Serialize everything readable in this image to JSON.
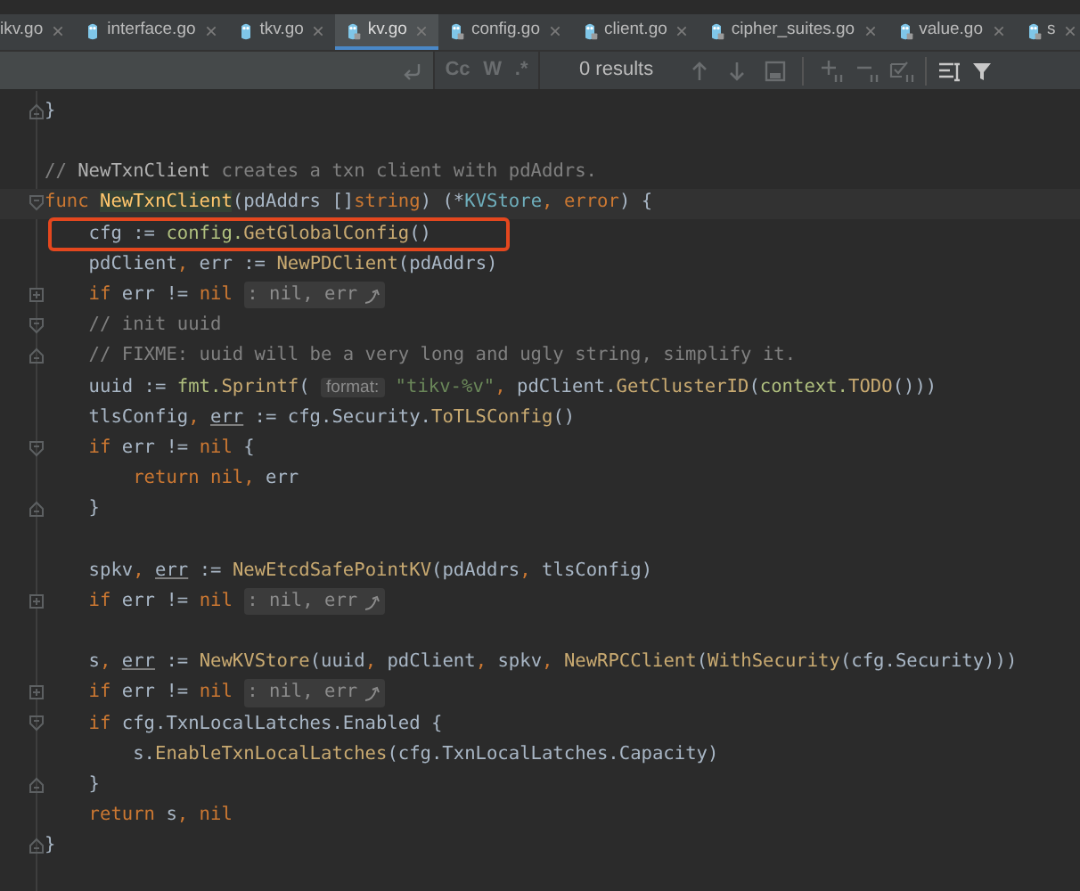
{
  "tabs": [
    {
      "label": "ikv.go",
      "selected": false
    },
    {
      "label": "interface.go",
      "selected": false,
      "locked": false
    },
    {
      "label": "tkv.go",
      "selected": false,
      "locked": false
    },
    {
      "label": "kv.go",
      "selected": true,
      "locked": true
    },
    {
      "label": "config.go",
      "selected": false,
      "locked": true
    },
    {
      "label": "client.go",
      "selected": false,
      "locked": true
    },
    {
      "label": "cipher_suites.go",
      "selected": false,
      "locked": true
    },
    {
      "label": "value.go",
      "selected": false,
      "locked": true
    },
    {
      "label": "s",
      "selected": false,
      "locked": true
    }
  ],
  "find_bar": {
    "options": [
      {
        "label": "Cc",
        "selected": false
      },
      {
        "label": "W",
        "selected": false
      },
      {
        "label": ".*",
        "selected": false
      }
    ],
    "results": "0 results"
  },
  "editor": {
    "lines": [
      {
        "kind": "fold_end",
        "segments": [
          {
            "kind": "plain",
            "text": "}"
          }
        ]
      },
      {
        "kind": "blank"
      },
      {
        "kind": "plain",
        "segments": [
          {
            "kind": "comment",
            "text": "// "
          },
          {
            "kind": "comment_ref",
            "text": "NewTxnClient"
          },
          {
            "kind": "comment",
            "text": " creates a txn client with pdAddrs."
          }
        ]
      },
      {
        "kind": "fold_start",
        "current": true,
        "segments": [
          {
            "kind": "keyword",
            "text": "func "
          },
          {
            "kind": "declaration",
            "text": "NewTxnClient"
          },
          {
            "kind": "plain",
            "text": "(pdAddrs []"
          },
          {
            "kind": "keyword",
            "text": "string"
          },
          {
            "kind": "plain",
            "text": ") (*"
          },
          {
            "kind": "type",
            "text": "KVStore"
          },
          {
            "kind": "keyword",
            "text": ", "
          },
          {
            "kind": "keyword",
            "text": "error"
          },
          {
            "kind": "plain",
            "text": ") {"
          }
        ]
      },
      {
        "kind": "plain",
        "annotated": true,
        "segments": [
          {
            "kind": "plain",
            "text": "    cfg := "
          },
          {
            "kind": "package",
            "text": "config."
          },
          {
            "kind": "call",
            "text": "GetGlobalConfig"
          },
          {
            "kind": "plain",
            "text": "()"
          }
        ]
      },
      {
        "kind": "plain",
        "segments": [
          {
            "kind": "plain",
            "text": "    pdClient"
          },
          {
            "kind": "keyword",
            "text": ","
          },
          {
            "kind": "plain",
            "text": " err := "
          },
          {
            "kind": "call",
            "text": "NewPDClient"
          },
          {
            "kind": "plain",
            "text": "(pdAddrs)"
          }
        ]
      },
      {
        "kind": "collapsed",
        "segments": [
          {
            "kind": "keyword",
            "text": "    if"
          },
          {
            "kind": "plain",
            "text": " err != "
          },
          {
            "kind": "keyword",
            "text": "nil "
          },
          {
            "kind": "folded_hint",
            "text": ": nil, err"
          }
        ]
      },
      {
        "kind": "fold_start",
        "segments": [
          {
            "kind": "comment",
            "text": "    // init uuid"
          }
        ]
      },
      {
        "kind": "fold_end",
        "segments": [
          {
            "kind": "comment",
            "text": "    // FIXME: uuid will be a very long and ugly string, simplify it."
          }
        ]
      },
      {
        "kind": "plain",
        "segments": [
          {
            "kind": "plain",
            "text": "    uuid := "
          },
          {
            "kind": "package",
            "text": "fmt."
          },
          {
            "kind": "call",
            "text": "Sprintf"
          },
          {
            "kind": "plain",
            "text": "( "
          },
          {
            "kind": "param_hint",
            "text": "format:"
          },
          {
            "kind": "string",
            "text": " \"tikv-%v\""
          },
          {
            "kind": "keyword",
            "text": ","
          },
          {
            "kind": "plain",
            "text": " pdClient."
          },
          {
            "kind": "call",
            "text": "GetClusterID"
          },
          {
            "kind": "plain",
            "text": "("
          },
          {
            "kind": "package",
            "text": "context."
          },
          {
            "kind": "call",
            "text": "TODO"
          },
          {
            "kind": "plain",
            "text": "()))"
          }
        ]
      },
      {
        "kind": "plain",
        "segments": [
          {
            "kind": "plain",
            "text": "    tlsConfig"
          },
          {
            "kind": "keyword",
            "text": ", "
          },
          {
            "kind": "reassigned",
            "text": "err"
          },
          {
            "kind": "plain",
            "text": " := cfg.Security."
          },
          {
            "kind": "call",
            "text": "ToTLSConfig"
          },
          {
            "kind": "plain",
            "text": "()"
          }
        ]
      },
      {
        "kind": "fold_start",
        "segments": [
          {
            "kind": "keyword",
            "text": "    if"
          },
          {
            "kind": "plain",
            "text": " err != "
          },
          {
            "kind": "keyword",
            "text": "nil"
          },
          {
            "kind": "plain",
            "text": " {"
          }
        ]
      },
      {
        "kind": "plain",
        "segments": [
          {
            "kind": "keyword",
            "text": "        return nil,"
          },
          {
            "kind": "plain",
            "text": " err"
          }
        ]
      },
      {
        "kind": "fold_end",
        "segments": [
          {
            "kind": "plain",
            "text": "    }"
          }
        ]
      },
      {
        "kind": "blank"
      },
      {
        "kind": "plain",
        "segments": [
          {
            "kind": "plain",
            "text": "    spkv"
          },
          {
            "kind": "keyword",
            "text": ", "
          },
          {
            "kind": "reassigned",
            "text": "err"
          },
          {
            "kind": "plain",
            "text": " := "
          },
          {
            "kind": "call",
            "text": "NewEtcdSafePointKV"
          },
          {
            "kind": "plain",
            "text": "(pdAddrs"
          },
          {
            "kind": "keyword",
            "text": ","
          },
          {
            "kind": "plain",
            "text": " tlsConfig)"
          }
        ]
      },
      {
        "kind": "collapsed",
        "segments": [
          {
            "kind": "keyword",
            "text": "    if"
          },
          {
            "kind": "plain",
            "text": " err != "
          },
          {
            "kind": "keyword",
            "text": "nil "
          },
          {
            "kind": "folded_hint",
            "text": ": nil, err"
          }
        ]
      },
      {
        "kind": "blank"
      },
      {
        "kind": "plain",
        "segments": [
          {
            "kind": "plain",
            "text": "    s"
          },
          {
            "kind": "keyword",
            "text": ", "
          },
          {
            "kind": "reassigned",
            "text": "err"
          },
          {
            "kind": "plain",
            "text": " := "
          },
          {
            "kind": "call",
            "text": "NewKVStore"
          },
          {
            "kind": "plain",
            "text": "(uuid"
          },
          {
            "kind": "keyword",
            "text": ","
          },
          {
            "kind": "plain",
            "text": " pdClient"
          },
          {
            "kind": "keyword",
            "text": ","
          },
          {
            "kind": "plain",
            "text": " spkv"
          },
          {
            "kind": "keyword",
            "text": ", "
          },
          {
            "kind": "call",
            "text": "NewRPCClient"
          },
          {
            "kind": "plain",
            "text": "("
          },
          {
            "kind": "call",
            "text": "WithSecurity"
          },
          {
            "kind": "plain",
            "text": "(cfg.Security)))"
          }
        ]
      },
      {
        "kind": "collapsed",
        "segments": [
          {
            "kind": "keyword",
            "text": "    if"
          },
          {
            "kind": "plain",
            "text": " err != "
          },
          {
            "kind": "keyword",
            "text": "nil "
          },
          {
            "kind": "folded_hint",
            "text": ": nil, err"
          }
        ]
      },
      {
        "kind": "fold_start",
        "segments": [
          {
            "kind": "keyword",
            "text": "    if"
          },
          {
            "kind": "plain",
            "text": " cfg.TxnLocalLatches.Enabled {"
          }
        ]
      },
      {
        "kind": "plain",
        "segments": [
          {
            "kind": "plain",
            "text": "        s."
          },
          {
            "kind": "call",
            "text": "EnableTxnLocalLatches"
          },
          {
            "kind": "plain",
            "text": "(cfg.TxnLocalLatches.Capacity)"
          }
        ]
      },
      {
        "kind": "fold_end",
        "segments": [
          {
            "kind": "plain",
            "text": "    }"
          }
        ]
      },
      {
        "kind": "plain",
        "segments": [
          {
            "kind": "keyword",
            "text": "    return"
          },
          {
            "kind": "plain",
            "text": " s"
          },
          {
            "kind": "keyword",
            "text": ", nil"
          }
        ]
      },
      {
        "kind": "fold_end",
        "segments": [
          {
            "kind": "plain",
            "text": "}"
          }
        ]
      }
    ]
  }
}
